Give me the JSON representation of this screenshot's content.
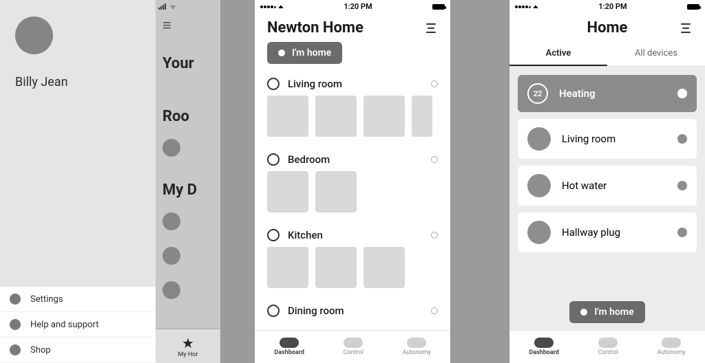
{
  "drawer": {
    "user_name": "Billy Jean",
    "menu": {
      "settings": "Settings",
      "help": "Help and support",
      "shop": "Shop"
    }
  },
  "behind": {
    "title1": "Your",
    "title2": "Roo",
    "title3": "My D",
    "tab_label": "My Hor"
  },
  "statusbar": {
    "time": "1:20 PM"
  },
  "center": {
    "title": "Newton Home",
    "home_button": "I'm home",
    "rooms": {
      "living": "Living room",
      "bedroom": "Bedroom",
      "kitchen": "Kitchen",
      "dining": "Dining room"
    }
  },
  "tabs": {
    "dashboard": "Dashboard",
    "control": "Control",
    "autonomy": "Autonomy"
  },
  "right": {
    "title": "Home",
    "tab_active": "Active",
    "tab_all": "All devices",
    "home_button": "I'm home",
    "devices": {
      "heating_temp": "22",
      "heating": "Heating",
      "living": "Living room",
      "hot_water": "Hot water",
      "hallway": "Hallway plug"
    }
  }
}
